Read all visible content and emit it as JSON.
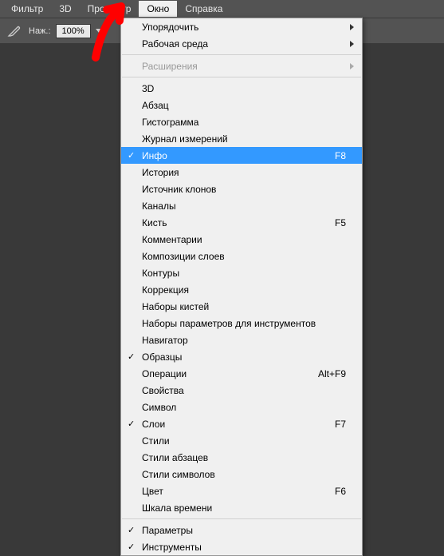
{
  "menubar": {
    "items": [
      {
        "label": "Фильтр",
        "active": false
      },
      {
        "label": "3D",
        "active": false
      },
      {
        "label": "Просмотр",
        "active": false
      },
      {
        "label": "Окно",
        "active": true
      },
      {
        "label": "Справка",
        "active": false
      }
    ]
  },
  "toolbar": {
    "pressure_label": "Наж.:",
    "pressure_value": "100%"
  },
  "dropdown": {
    "groups": [
      [
        {
          "label": "Упорядочить",
          "submenu": true
        },
        {
          "label": "Рабочая среда",
          "submenu": true
        }
      ],
      [
        {
          "label": "Расширения",
          "submenu": true,
          "disabled": true
        }
      ],
      [
        {
          "label": "3D"
        },
        {
          "label": "Абзац"
        },
        {
          "label": "Гистограмма"
        },
        {
          "label": "Журнал измерений"
        },
        {
          "label": "Инфо",
          "shortcut": "F8",
          "highlighted": true,
          "checked": true
        },
        {
          "label": "История"
        },
        {
          "label": "Источник клонов"
        },
        {
          "label": "Каналы"
        },
        {
          "label": "Кисть",
          "shortcut": "F5"
        },
        {
          "label": "Комментарии"
        },
        {
          "label": "Композиции слоев"
        },
        {
          "label": "Контуры"
        },
        {
          "label": "Коррекция"
        },
        {
          "label": "Наборы кистей"
        },
        {
          "label": "Наборы параметров для инструментов"
        },
        {
          "label": "Навигатор"
        },
        {
          "label": "Образцы",
          "checked": true
        },
        {
          "label": "Операции",
          "shortcut": "Alt+F9"
        },
        {
          "label": "Свойства"
        },
        {
          "label": "Символ"
        },
        {
          "label": "Слои",
          "shortcut": "F7",
          "checked": true
        },
        {
          "label": "Стили"
        },
        {
          "label": "Стили абзацев"
        },
        {
          "label": "Стили символов"
        },
        {
          "label": "Цвет",
          "shortcut": "F6"
        },
        {
          "label": "Шкала времени"
        }
      ],
      [
        {
          "label": "Параметры",
          "checked": true
        },
        {
          "label": "Инструменты",
          "checked": true
        }
      ]
    ]
  }
}
